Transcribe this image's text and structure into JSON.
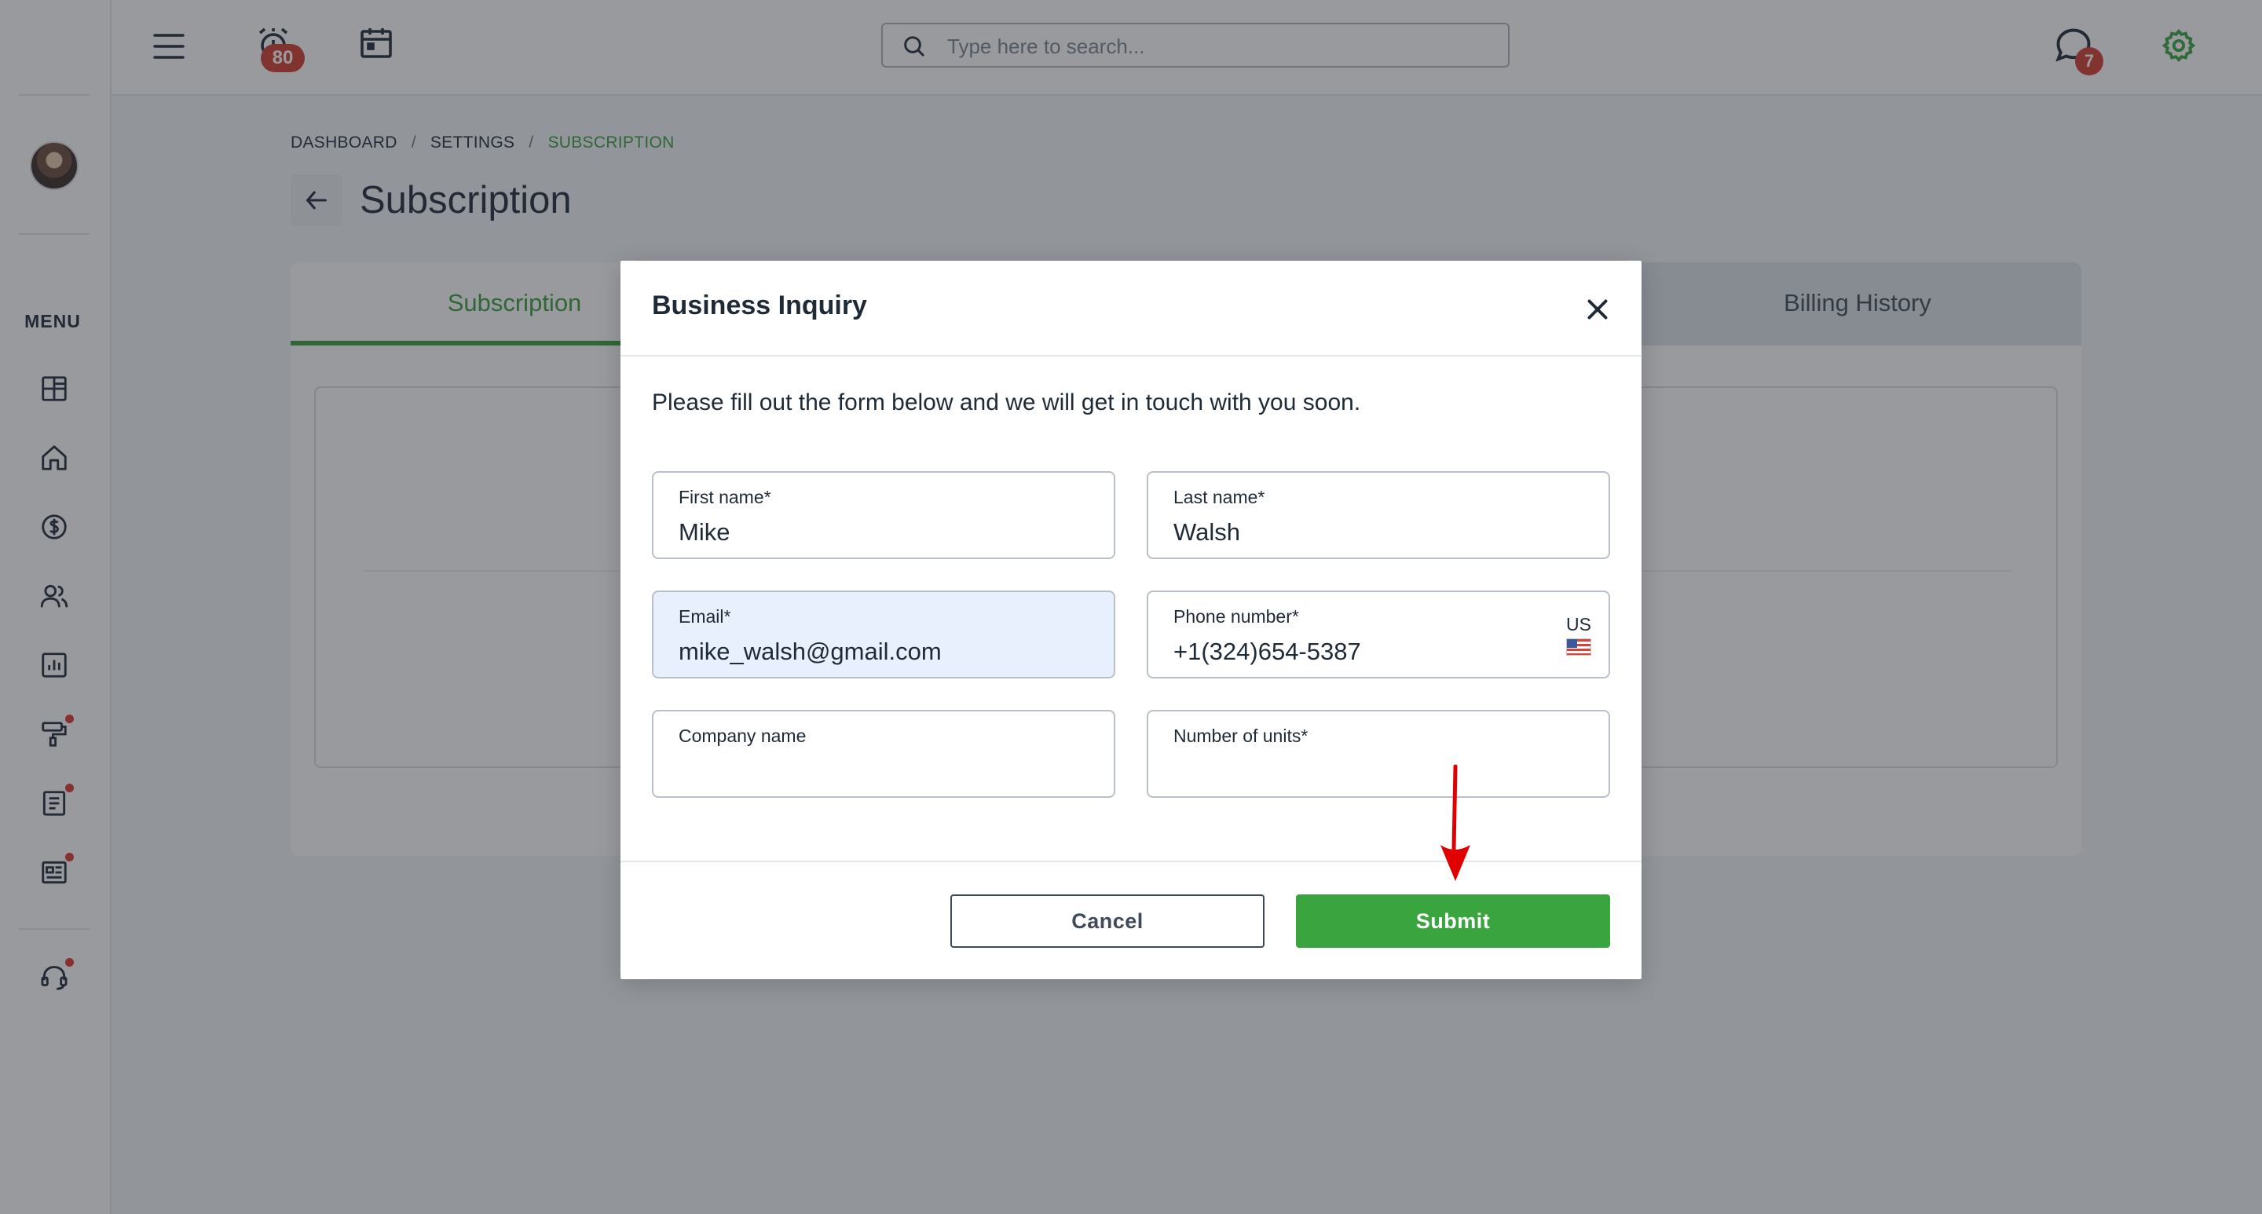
{
  "topbar": {
    "alerts_badge": "80",
    "messages_badge": "7",
    "search_placeholder": "Type here to search..."
  },
  "sidebar": {
    "menu_label": "MENU",
    "items": [
      {
        "icon": "dashboard-grid-icon",
        "dot": false
      },
      {
        "icon": "home-icon",
        "dot": false
      },
      {
        "icon": "dollar-coin-icon",
        "dot": false
      },
      {
        "icon": "users-icon",
        "dot": false
      },
      {
        "icon": "bar-chart-icon",
        "dot": false
      },
      {
        "icon": "paint-roller-icon",
        "dot": true
      },
      {
        "icon": "document-icon",
        "dot": true
      },
      {
        "icon": "newspaper-icon",
        "dot": true
      },
      {
        "icon": "headset-support-icon",
        "dot": true
      }
    ]
  },
  "breadcrumb": {
    "items": [
      "DASHBOARD",
      "SETTINGS",
      "SUBSCRIPTION"
    ],
    "separator": "/"
  },
  "page": {
    "title": "Subscription",
    "tabs": [
      {
        "label": "Subscription",
        "active": true
      },
      {
        "label": "Billing History",
        "active": false
      }
    ]
  },
  "modal": {
    "title": "Business Inquiry",
    "description": "Please fill out the form below and we will get in touch with you soon.",
    "fields": {
      "first_name": {
        "label": "First name*",
        "value": "Mike"
      },
      "last_name": {
        "label": "Last name*",
        "value": "Walsh"
      },
      "email": {
        "label": "Email*",
        "value": "mike_walsh@gmail.com"
      },
      "phone": {
        "label": "Phone number*",
        "value": "+1(324)654-5387",
        "country": "US"
      },
      "company": {
        "label": "Company name",
        "value": ""
      },
      "units": {
        "label": "Number of units*",
        "value": ""
      }
    },
    "cancel_label": "Cancel",
    "submit_label": "Submit"
  },
  "colors": {
    "brand_green": "#3aa43f",
    "badge_red": "#d33b2c",
    "annotation_arrow": "#e00000"
  }
}
